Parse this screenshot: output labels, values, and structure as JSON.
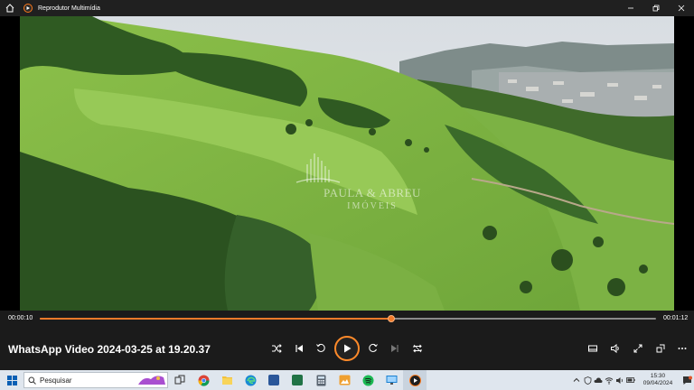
{
  "window": {
    "title": "Reprodutor Multimídia"
  },
  "video": {
    "watermark_name": "PAULA & ABREU",
    "watermark_sub": "IMÓVEIS"
  },
  "player": {
    "current_time": "00:00:10",
    "total_time": "00:01:12",
    "progress": 0.57,
    "media_title": "WhatsApp Video 2024-03-25 at 19.20.37"
  },
  "taskbar": {
    "search_placeholder": "Pesquisar",
    "time": "15:30",
    "date": "09/04/2024",
    "apps": [
      "widgets",
      "task-view",
      "chrome",
      "file-explorer",
      "edge",
      "word",
      "excel",
      "calculator",
      "photos",
      "spotify",
      "remote-desktop",
      "media-player"
    ]
  },
  "colors": {
    "accent": "#f07a2a",
    "titlebar": "#202020",
    "controls": "#1b1b1b",
    "taskbar": "#dfe6ee"
  }
}
